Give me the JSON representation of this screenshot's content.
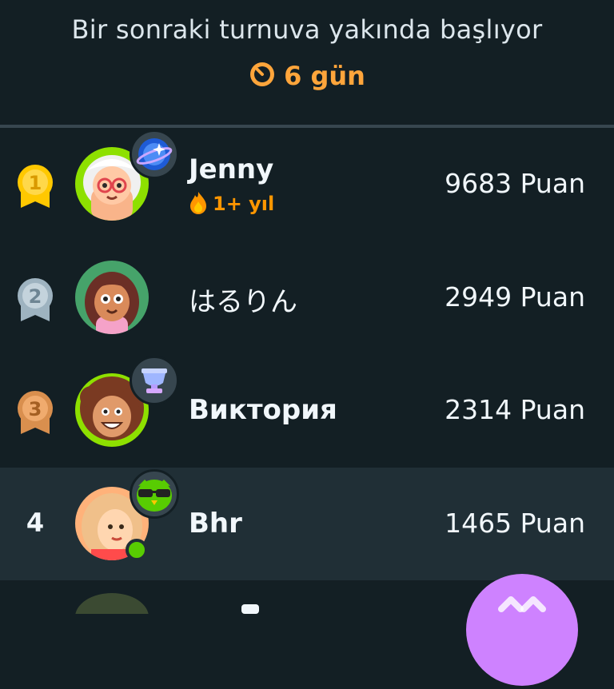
{
  "header": {
    "title": "Bir sonraki turnuva yakında başlıyor",
    "countdown": "6 gün"
  },
  "colors": {
    "background": "#131f24",
    "highlight_row": "#202f36",
    "accent_orange": "#ffa53b",
    "gold": "#ffc800",
    "silver": "#9eb3c0",
    "bronze": "#d98f4e",
    "fab": "#ce82ff"
  },
  "leaderboard": [
    {
      "rank": "1",
      "rank_icon": "gold-medal-icon",
      "name": "Jenny",
      "streak": "1+ yıl",
      "points": "9683 Puan",
      "badge": "planet-badge-icon"
    },
    {
      "rank": "2",
      "rank_icon": "silver-medal-icon",
      "name": "はるりん",
      "points": "2949 Puan"
    },
    {
      "rank": "3",
      "rank_icon": "bronze-medal-icon",
      "name": "Виктория",
      "points": "2314 Puan",
      "badge": "trophy-badge-icon"
    },
    {
      "rank": "4",
      "name": "Bhr",
      "points": "1465 Puan",
      "badge": "sunglasses-owl-badge-icon",
      "online": true
    }
  ]
}
